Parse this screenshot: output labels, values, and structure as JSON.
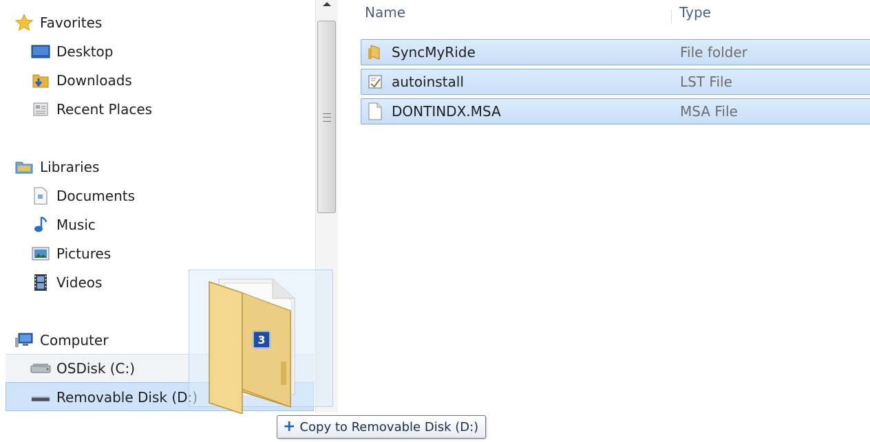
{
  "nav": {
    "favorites": {
      "label": "Favorites",
      "icon": "star-icon"
    },
    "favorites_items": [
      {
        "label": "Desktop",
        "icon": "desktop-icon"
      },
      {
        "label": "Downloads",
        "icon": "downloads-folder-icon"
      },
      {
        "label": "Recent Places",
        "icon": "recent-places-icon"
      }
    ],
    "libraries": {
      "label": "Libraries",
      "icon": "libraries-icon"
    },
    "libraries_items": [
      {
        "label": "Documents",
        "icon": "document-icon"
      },
      {
        "label": "Music",
        "icon": "music-note-icon"
      },
      {
        "label": "Pictures",
        "icon": "picture-icon"
      },
      {
        "label": "Videos",
        "icon": "film-icon"
      }
    ],
    "computer": {
      "label": "Computer",
      "icon": "computer-icon"
    },
    "computer_items": [
      {
        "label": "OSDisk (C:)",
        "icon": "hard-drive-icon"
      },
      {
        "label": "Removable Disk (D:)",
        "icon": "removable-drive-icon"
      }
    ]
  },
  "content": {
    "columns": {
      "name": "Name",
      "type": "Type"
    },
    "files": [
      {
        "name": "SyncMyRide",
        "type": "File folder",
        "icon": "folder-icon"
      },
      {
        "name": "autoinstall",
        "type": "LST File",
        "icon": "text-file-icon"
      },
      {
        "name": "DONTINDX.MSA",
        "type": "MSA File",
        "icon": "blank-file-icon"
      }
    ]
  },
  "drag": {
    "count": "3",
    "tooltip": "Copy to Removable Disk (D:)"
  },
  "colors": {
    "selection": "#cce4fb",
    "selection_border": "#84acdd",
    "header_text": "#4c607a",
    "type_text": "#6d6d6d",
    "badge": "#1f4da3"
  }
}
